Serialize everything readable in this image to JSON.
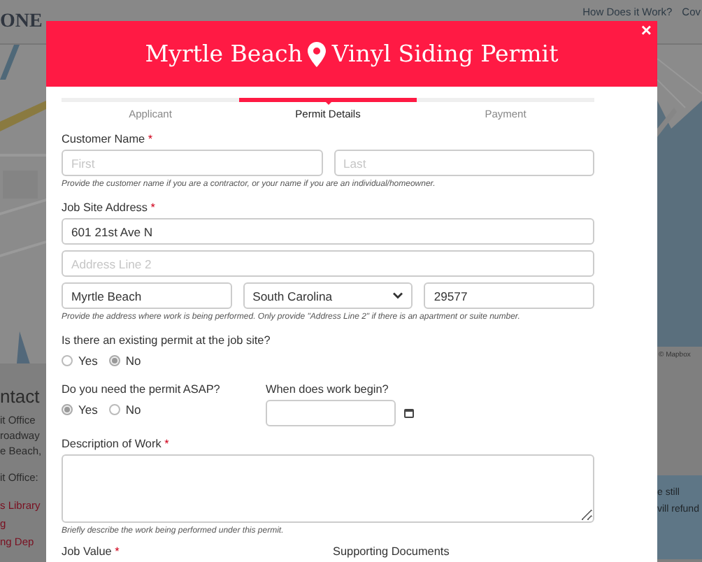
{
  "background_page": {
    "logo": "ONE",
    "nav": [
      "How Does it Work?",
      "Cov"
    ],
    "map_attribution": "© Mapbox",
    "contact": {
      "heading": "ntact",
      "lines": [
        "it Office",
        "roadway",
        "e Beach,",
        "it Office:"
      ],
      "links": [
        "s Library",
        "g",
        "ng Dep"
      ]
    },
    "notice": [
      "e still",
      "vill refund"
    ]
  },
  "modal": {
    "title": {
      "before": "Myrtle Beach",
      "after": "Vinyl Siding Permit"
    },
    "close": "×",
    "steps": [
      {
        "label": "Applicant",
        "selected": false
      },
      {
        "label": "Permit Details",
        "selected": true
      },
      {
        "label": "Payment",
        "selected": false
      }
    ],
    "customer_name": {
      "label": "Customer Name",
      "required_mark": "*",
      "first_placeholder": "First",
      "last_placeholder": "Last",
      "help": "Provide the customer name if you are a contractor, or your name if you are an individual/homeowner."
    },
    "job_site_address": {
      "label": "Job Site Address",
      "required_mark": "*",
      "line1": "601 21st Ave N",
      "line2_placeholder": "Address Line 2",
      "city": "Myrtle Beach",
      "state": "South Carolina",
      "zip": "29577",
      "help": "Provide the address where work is being performed. Only provide \"Address Line 2\" if there is an apartment or suite number."
    },
    "existing_permit": {
      "question": "Is there an existing permit at the job site?",
      "options": [
        {
          "label": "Yes",
          "selected": false
        },
        {
          "label": "No",
          "selected": true
        }
      ]
    },
    "asap": {
      "question": "Do you need the permit ASAP?",
      "options": [
        {
          "label": "Yes",
          "selected": true
        },
        {
          "label": "No",
          "selected": false
        }
      ]
    },
    "work_begin": {
      "label": "When does work begin?"
    },
    "description": {
      "label": "Description of Work",
      "required_mark": "*",
      "help": "Briefly describe the work being performed under this permit."
    },
    "job_value": {
      "label": "Job Value",
      "required_mark": "*"
    },
    "supporting_documents": {
      "label": "Supporting Documents"
    }
  }
}
